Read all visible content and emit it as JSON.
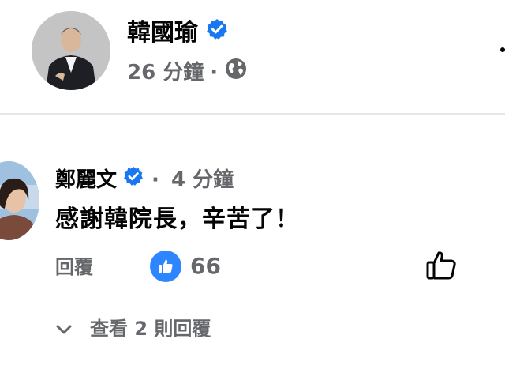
{
  "post": {
    "author": "韓國瑜",
    "time": "26 分鐘",
    "separator": "·",
    "audience_icon": "globe-icon"
  },
  "comment": {
    "author": "鄭麗文",
    "separator": "·",
    "time": "4 分鐘",
    "text": "感謝韓院長，辛苦了！",
    "reply_label": "回覆",
    "like_count": "66",
    "view_replies_label": "查看 2 則回覆"
  },
  "colors": {
    "verified_blue": "#1877f2",
    "like_blue": "#2d86ff",
    "secondary_text": "#65676b",
    "divider": "#e4e6eb"
  }
}
